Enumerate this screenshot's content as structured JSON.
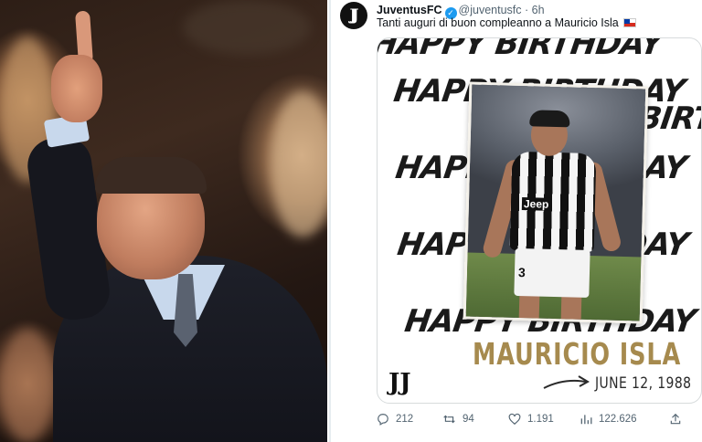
{
  "tweet": {
    "avatar_glyph": "JJ",
    "display_name": "JuventusFC",
    "handle": "@juventusfc",
    "separator": "·",
    "time": "6h",
    "text": "Tanti auguri di buon compleanno a Mauricio Isla",
    "flag_icon": "chile-flag-icon"
  },
  "media": {
    "headline_rows": [
      "HAPPY BIRTHDAY",
      "HAPPY BIRTHDAY",
      "HAPPY BIRTHDAY",
      "HAPPY BIRTHDAY",
      "HAPPY BIRTHDAY",
      "HAPPY BIRTHDAY"
    ],
    "sponsor": "Jeep",
    "shirt_number": "3",
    "player_name": "MAURICIO ISLA",
    "date_of_birth": "JUNE 12, 1988",
    "logo_glyph": "JJ",
    "name_color": "#a68a4e"
  },
  "actions": {
    "replies": "212",
    "retweets": "94",
    "likes": "1.191",
    "views": "122.626"
  },
  "colors": {
    "accent": "#1d9bf0",
    "muted_text": "#536471"
  }
}
